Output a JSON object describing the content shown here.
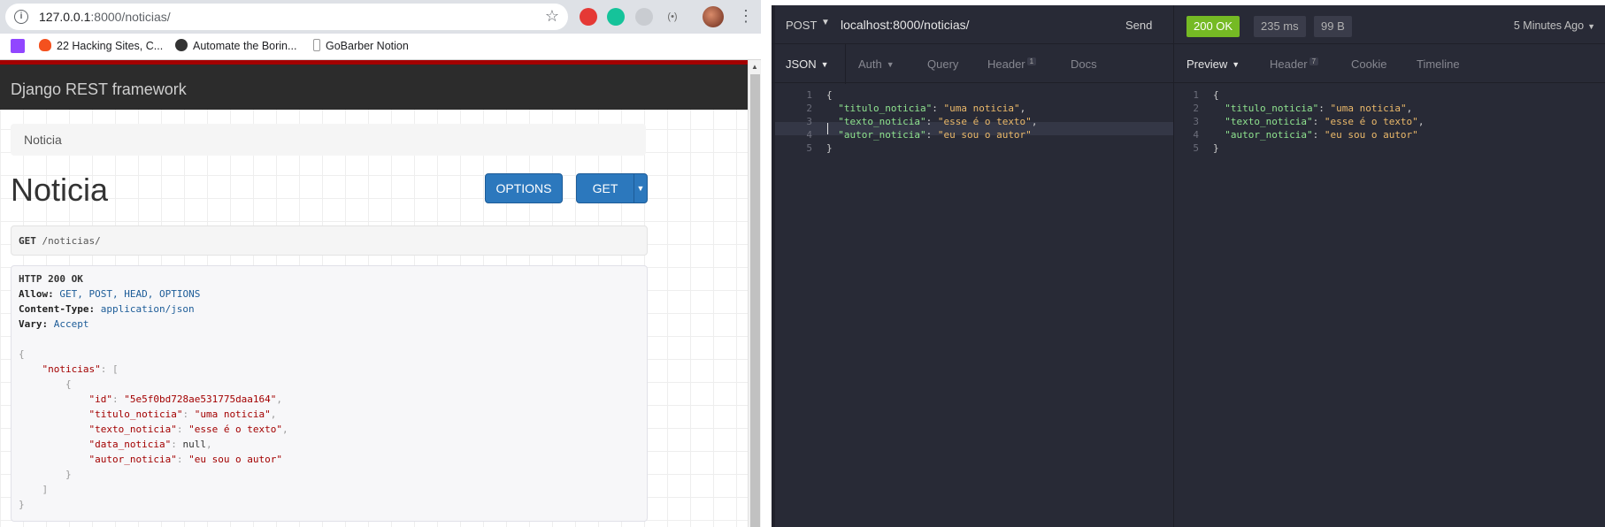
{
  "browser": {
    "url_host": "127.0.0.1",
    "url_path": ":8000/noticias/",
    "bookmarks": [
      "22 Hacking Sites, C...",
      "Automate the Borin...",
      "GoBarber Notion"
    ]
  },
  "drf": {
    "brand": "Django REST framework",
    "breadcrumb": "Noticia",
    "title": "Noticia",
    "options_label": "OPTIONS",
    "get_label": "GET",
    "request_method": "GET",
    "request_path": "/noticias/",
    "response": {
      "status": "HTTP 200 OK",
      "headers": [
        {
          "key": "Allow:",
          "value": "GET, POST, HEAD, OPTIONS"
        },
        {
          "key": "Content-Type:",
          "value": "application/json"
        },
        {
          "key": "Vary:",
          "value": "Accept"
        }
      ],
      "list_key": "\"noticias\"",
      "fields": [
        {
          "key": "\"id\"",
          "value": "\"5e5f0bd728ae531775daa164\""
        },
        {
          "key": "\"titulo_noticia\"",
          "value": "\"uma noticia\""
        },
        {
          "key": "\"texto_noticia\"",
          "value": "\"esse é o texto\""
        },
        {
          "key": "\"data_noticia\"",
          "value": "null"
        },
        {
          "key": "\"autor_noticia\"",
          "value": "\"eu sou o autor\""
        }
      ]
    }
  },
  "insomnia": {
    "method": "POST",
    "url": "localhost:8000/noticias/",
    "send_label": "Send",
    "request_tabs": {
      "json": "JSON",
      "auth": "Auth",
      "query": "Query",
      "header": "Header",
      "header_count": "1",
      "docs": "Docs"
    },
    "request_body": [
      {
        "ln": "1",
        "text": "{"
      },
      {
        "ln": "2",
        "key": "\"titulo_noticia\"",
        "value": "\"uma noticia\"",
        "trail": ","
      },
      {
        "ln": "3",
        "key": "\"texto_noticia\"",
        "value": "\"esse é o texto\"",
        "trail": ","
      },
      {
        "ln": "4",
        "key": "\"autor_noticia\"",
        "value": "\"eu sou o autor\"",
        "trail": ""
      },
      {
        "ln": "5",
        "text": "}"
      }
    ],
    "status": "200 OK",
    "time": "235 ms",
    "size": "99 B",
    "ago": "5 Minutes Ago",
    "response_tabs": {
      "preview": "Preview",
      "header": "Header",
      "header_count": "7",
      "cookie": "Cookie",
      "timeline": "Timeline"
    },
    "response_body": [
      {
        "ln": "1",
        "text": "{"
      },
      {
        "ln": "2",
        "key": "\"titulo_noticia\"",
        "value": "\"uma noticia\"",
        "trail": ","
      },
      {
        "ln": "3",
        "key": "\"texto_noticia\"",
        "value": "\"esse é o texto\"",
        "trail": ","
      },
      {
        "ln": "4",
        "key": "\"autor_noticia\"",
        "value": "\"eu sou o autor\"",
        "trail": ""
      },
      {
        "ln": "5",
        "text": "}"
      }
    ]
  }
}
